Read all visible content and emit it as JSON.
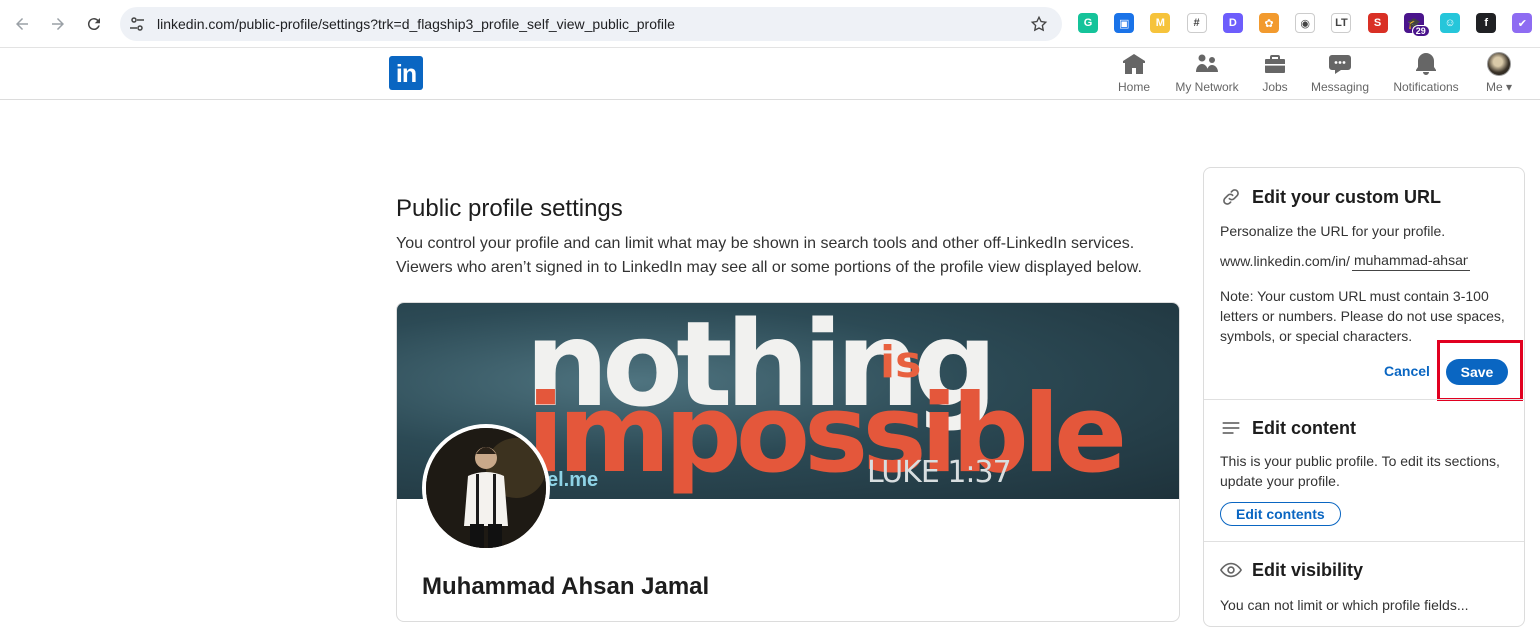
{
  "browser": {
    "url": "linkedin.com/public-profile/settings?trk=d_flagship3_profile_self_view_public_profile",
    "extensions": [
      {
        "name": "grammarly-extension",
        "color": "#15c39a",
        "glyph": "G"
      },
      {
        "name": "screenshot-extension",
        "color": "#1a73e8",
        "glyph": "▣"
      },
      {
        "name": "m-extension",
        "color": "#f6c33b",
        "glyph": "M"
      },
      {
        "name": "hashtag-extension",
        "color": "#ffffff",
        "glyph": "#"
      },
      {
        "name": "d-extension",
        "color": "#6d5dfc",
        "glyph": "D"
      },
      {
        "name": "sunflower-extension",
        "color": "#f29a2e",
        "glyph": "✿"
      },
      {
        "name": "camera-extension",
        "color": "#ffffff",
        "glyph": "◉"
      },
      {
        "name": "lt-extension",
        "color": "#ffffff",
        "glyph": "LT"
      },
      {
        "name": "s-extension",
        "color": "#d93025",
        "glyph": "S"
      },
      {
        "name": "graduation-extension",
        "color": "#4a148c",
        "glyph": "🎓"
      },
      {
        "name": "smiley-extension",
        "color": "#26c6da",
        "glyph": "☺"
      },
      {
        "name": "f-extension",
        "color": "#202124",
        "glyph": "f"
      },
      {
        "name": "check-extension",
        "color": "#8e6cf2",
        "glyph": "✔"
      }
    ],
    "badge_count": "29"
  },
  "header": {
    "logo": "in",
    "nav": [
      {
        "label": "Home",
        "icon": "home-icon"
      },
      {
        "label": "My Network",
        "icon": "network-icon"
      },
      {
        "label": "Jobs",
        "icon": "briefcase-icon"
      },
      {
        "label": "Messaging",
        "icon": "messaging-icon"
      },
      {
        "label": "Notifications",
        "icon": "bell-icon"
      },
      {
        "label": "Me",
        "icon": "avatar"
      }
    ]
  },
  "main": {
    "title": "Public profile settings",
    "description": "You control your profile and can limit what may be shown in search tools and other off-LinkedIn services. Viewers who aren’t signed in to LinkedIn may see all or some portions of the profile view displayed below.",
    "banner_text": {
      "line1": "nothing",
      "is": "is",
      "line2": "impossible",
      "verse": "LUKE 1:37",
      "watermark": "el.me"
    },
    "profile_name": "Muhammad Ahsan Jamal"
  },
  "sidebar": {
    "custom_url": {
      "title": "Edit your custom URL",
      "subtitle": "Personalize the URL for your profile.",
      "prefix": "www.linkedin.com/in/",
      "value": "muhammad-ahsan",
      "note": "Note: Your custom URL must contain 3-100 letters or numbers. Please do not use spaces, symbols, or special characters.",
      "cancel": "Cancel",
      "save": "Save"
    },
    "content": {
      "title": "Edit content",
      "text": "This is your public profile. To edit its sections, update your profile.",
      "button": "Edit contents"
    },
    "visibility": {
      "title": "Edit visibility",
      "text": "You can not limit or which profile fields..."
    },
    "highlight_color": "#e10020",
    "accent": "#0a66c2"
  }
}
